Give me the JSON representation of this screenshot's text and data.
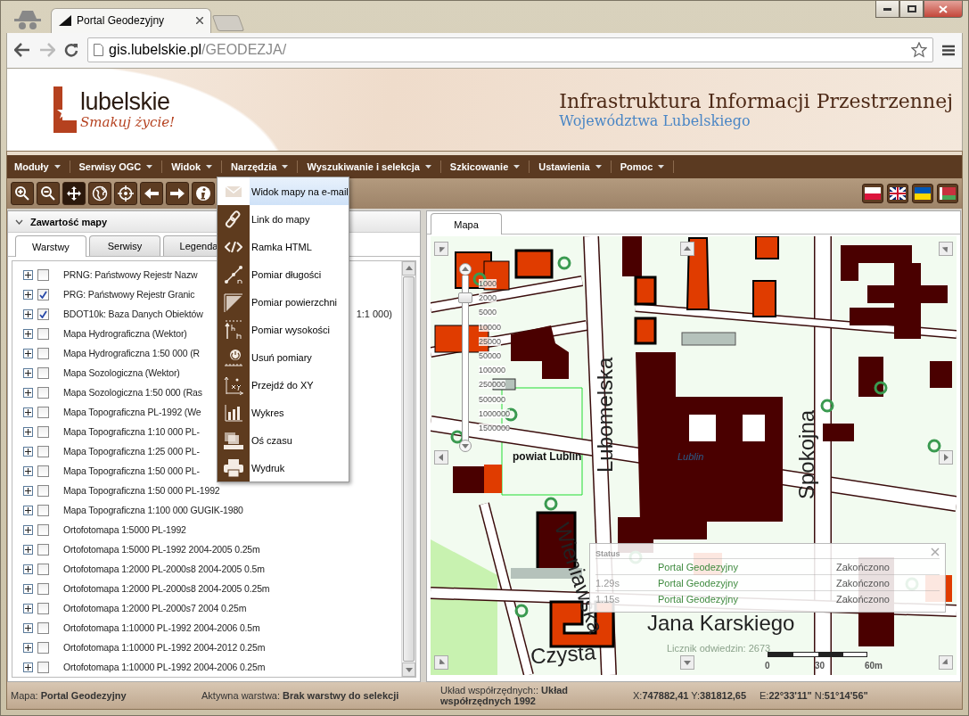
{
  "browser": {
    "tab_title": "Portal Geodezyjny",
    "url_host": "gis.lubelskie.pl",
    "url_path": "/GEODEZJA/",
    "forward_disabled": true
  },
  "banner": {
    "logo_word": "lubelskie",
    "logo_slogan": "Smakuj życie!",
    "title": "Infrastruktura Informacji Przestrzennej",
    "subtitle": "Województwa Lubelskiego"
  },
  "menu": [
    {
      "label": "Moduły"
    },
    {
      "label": "Serwisy OGC"
    },
    {
      "label": "Widok"
    },
    {
      "label": "Narzędzia"
    },
    {
      "label": "Wyszukiwanie i selekcja"
    },
    {
      "label": "Szkicowanie"
    },
    {
      "label": "Ustawienia"
    },
    {
      "label": "Pomoc"
    }
  ],
  "tools": [
    {
      "selected": false
    },
    {
      "selected": false
    },
    {
      "selected": true
    },
    {
      "selected": false
    },
    {
      "selected": false
    },
    {
      "selected": false
    },
    {
      "selected": false
    },
    {
      "selected": false
    }
  ],
  "left_panel": {
    "title": "Zawartość mapy",
    "tabs": [
      {
        "label": "Warstwy",
        "selected": true
      },
      {
        "label": "Serwisy",
        "selected": false
      },
      {
        "label": "Legenda",
        "selected": false
      }
    ],
    "layers": [
      {
        "label": "PRNG: Państwowy Rejestr Nazw",
        "checked": false
      },
      {
        "label": "PRG: Państwowy Rejestr Granic",
        "checked": true
      },
      {
        "label": "BDOT10k: Baza Danych Obiektów",
        "tail": "1:1 000)",
        "checked": true
      },
      {
        "label": "Mapa Hydrograficzna (Wektor)",
        "checked": false
      },
      {
        "label": "Mapa Hydrograficzna 1:50 000 (R",
        "checked": false
      },
      {
        "label": "Mapa Sozologiczna (Wektor)",
        "checked": false
      },
      {
        "label": "Mapa Sozologiczna 1:50 000 (Ras",
        "checked": false
      },
      {
        "label": "Mapa Topograficzna PL-1992 (We",
        "checked": false
      },
      {
        "label": "Mapa Topograficzna 1:10 000 PL-",
        "checked": false
      },
      {
        "label": "Mapa Topograficzna 1:25 000 PL-",
        "checked": false
      },
      {
        "label": "Mapa Topograficzna 1:50 000 PL-",
        "checked": false
      },
      {
        "label": "Mapa Topograficzna 1:50 000 PL-1992",
        "checked": false
      },
      {
        "label": "Mapa Topograficzna 1:100 000 GUGIK-1980",
        "checked": false
      },
      {
        "label": "Ortofotomapa 1:5000 PL-1992",
        "checked": false
      },
      {
        "label": "Ortofotomapa 1:5000 PL-1992 2004-2005 0.25m",
        "checked": false
      },
      {
        "label": "Ortofotomapa 1:2000 PL-2000s8 2004-2005 0.5m",
        "checked": false
      },
      {
        "label": "Ortofotomapa 1:2000 PL-2000s8 2004-2005 0.25m",
        "checked": false
      },
      {
        "label": "Ortofotomapa 1:2000 PL-2000s7 2004 0.25m",
        "checked": false
      },
      {
        "label": "Ortofotomapa 1:10000 PL-1992 2004-2006 0.5m",
        "checked": false
      },
      {
        "label": "Ortofotomapa 1:10000 PL-1992 2004-2012 0.25m",
        "checked": false
      },
      {
        "label": "Ortofotomapa 1:10000 PL-1992 2004-2006 0.25m",
        "checked": false
      }
    ]
  },
  "tools_menu": [
    {
      "label": "Widok mapy na e-mail",
      "highlighted": true
    },
    {
      "label": "Link do mapy",
      "highlighted": false
    },
    {
      "label": "Ramka HTML",
      "highlighted": false
    },
    {
      "label": "Pomiar długości",
      "highlighted": false
    },
    {
      "label": "Pomiar powierzchni",
      "highlighted": false
    },
    {
      "label": "Pomiar wysokości",
      "highlighted": false
    },
    {
      "label": "Usuń pomiary",
      "highlighted": false
    },
    {
      "label": "Przejdź do XY",
      "highlighted": false
    },
    {
      "label": "Wykres",
      "highlighted": false
    },
    {
      "label": "Oś czasu",
      "highlighted": false
    },
    {
      "label": "Wydruk",
      "highlighted": false
    }
  ],
  "map_panel": {
    "tabs": [
      {
        "label": "Mapa",
        "selected": true
      }
    ],
    "zoom": {
      "level": 0.9,
      "scales": [
        "1000",
        "2000",
        "5000",
        "10000",
        "25000",
        "50000",
        "100000",
        "250000",
        "500000",
        "1000000",
        "1500000"
      ]
    },
    "labels": [
      {
        "text": "Lubomelska",
        "kind": "street"
      },
      {
        "text": "Spokojna",
        "kind": "street"
      },
      {
        "text": "Wieniawska",
        "kind": "street"
      },
      {
        "text": "Czysta",
        "kind": "street"
      },
      {
        "text": "Jana Karskiego",
        "kind": "street"
      },
      {
        "text": "powiat Lublin",
        "kind": "district"
      },
      {
        "text": "Lublin",
        "kind": "city"
      }
    ],
    "status_window": {
      "title": "Status",
      "rows": [
        {
          "name": "Portal Geodezyjny",
          "state": "Zakończono"
        },
        {
          "time": "1.29s",
          "name": "Portal Geodezyjny",
          "state": "Zakończono"
        },
        {
          "time": "1.15s",
          "name": "Portal Geodezyjny",
          "state": "Zakończono"
        }
      ]
    },
    "visit_counter": "Licznik odwiedzin: 2673",
    "scale_bar": [
      "0",
      "30",
      "60m"
    ]
  },
  "status_bar": [
    "Mapa: **Portal Geodezyjny**",
    "Aktywna warstwa: **Brak warstwy do selekcji**",
    "Układ współrzędnych:: **Układ współrzędnych 1992**",
    "X:**747882,41** Y:**381812,65**",
    "E:**22°33'11\"** N:**51°14'56\"**"
  ]
}
